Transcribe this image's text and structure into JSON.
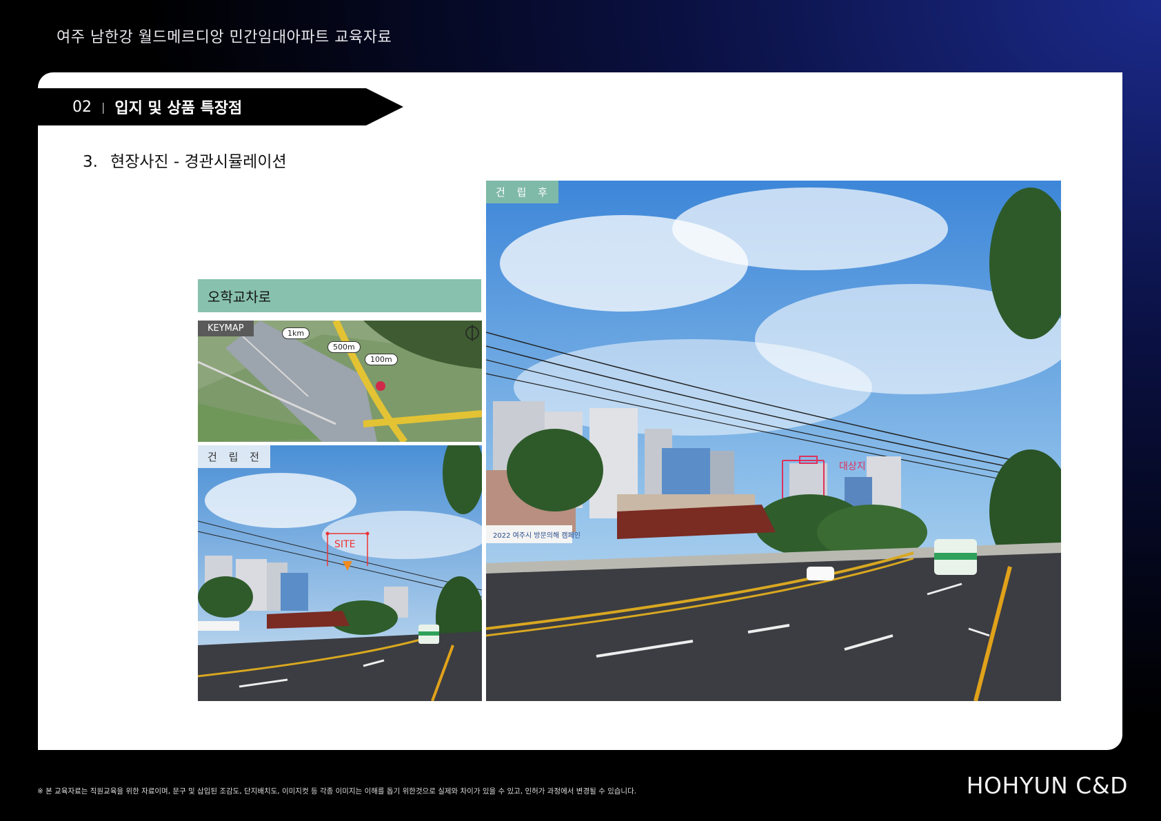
{
  "header": {
    "title": "여주 남한강 월드메르디앙 민간임대아파트 교육자료"
  },
  "section": {
    "number": "02",
    "separator": "|",
    "title": "입지 및 상품 특장점"
  },
  "subsection": {
    "number": "3.",
    "title": "현장사진 - 경관시뮬레이션"
  },
  "road_name": "오학교차로",
  "keymap": {
    "label": "KEYMAP",
    "distances": [
      "1km",
      "500m",
      "100m"
    ]
  },
  "photos": {
    "before_label": "건 립 전",
    "after_label": "건 립 후",
    "site_marker": "SITE",
    "target_marker": "대상지",
    "banner_text": "2022 여주시 방문의해 캠페인"
  },
  "footer": {
    "note": "※ 본 교육자료는 직원교육을 위한 자료이며, 문구 및 삽입된 조감도, 단지배치도, 이미지컷 등 각종 이미지는 이해를 돕기 위한것으로 실제와 차이가 있을 수 있고, 인허가 과정에서 변경될 수 있습니다.",
    "brand": "HOHYUN C&D"
  },
  "colors": {
    "accent_green": "#88c1ae",
    "marker_red": "#e0305a",
    "banner_black": "#000000"
  }
}
